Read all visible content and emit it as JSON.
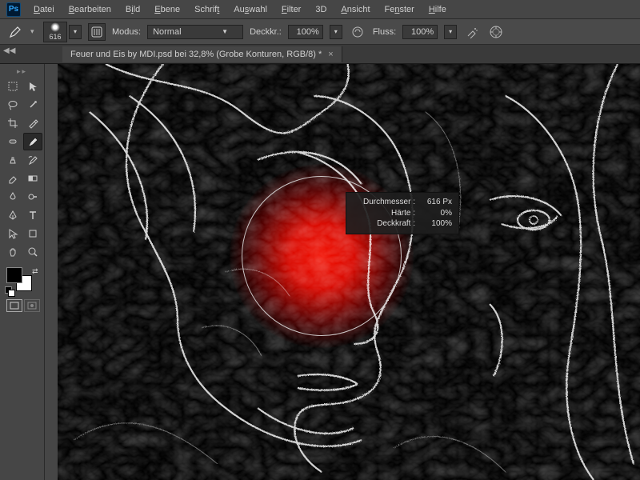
{
  "app": {
    "logo_text": "Ps"
  },
  "menu": {
    "datei": "Datei",
    "bearbeiten": "Bearbeiten",
    "bild": "Bild",
    "ebene": "Ebene",
    "schrift": "Schrift",
    "auswahl": "Auswahl",
    "filter": "Filter",
    "dreid": "3D",
    "ansicht": "Ansicht",
    "fenster": "Fenster",
    "hilfe": "Hilfe"
  },
  "options": {
    "brush_size": "616",
    "modus_label": "Modus:",
    "modus_value": "Normal",
    "deckkr_label": "Deckkr.:",
    "deckkr_value": "100%",
    "fluss_label": "Fluss:",
    "fluss_value": "100%"
  },
  "tab": {
    "title": "Feuer und Eis by MDI.psd bei 32,8% (Grobe Konturen, RGB/8) *",
    "close": "×"
  },
  "hud": {
    "durchmesser_label": "Durchmesser :",
    "durchmesser_value": "616 Px",
    "haerte_label": "Härte :",
    "haerte_value": "0%",
    "deckkraft_label": "Deckkraft :",
    "deckkraft_value": "100%"
  },
  "colors": {
    "accent": "#ff2200"
  }
}
